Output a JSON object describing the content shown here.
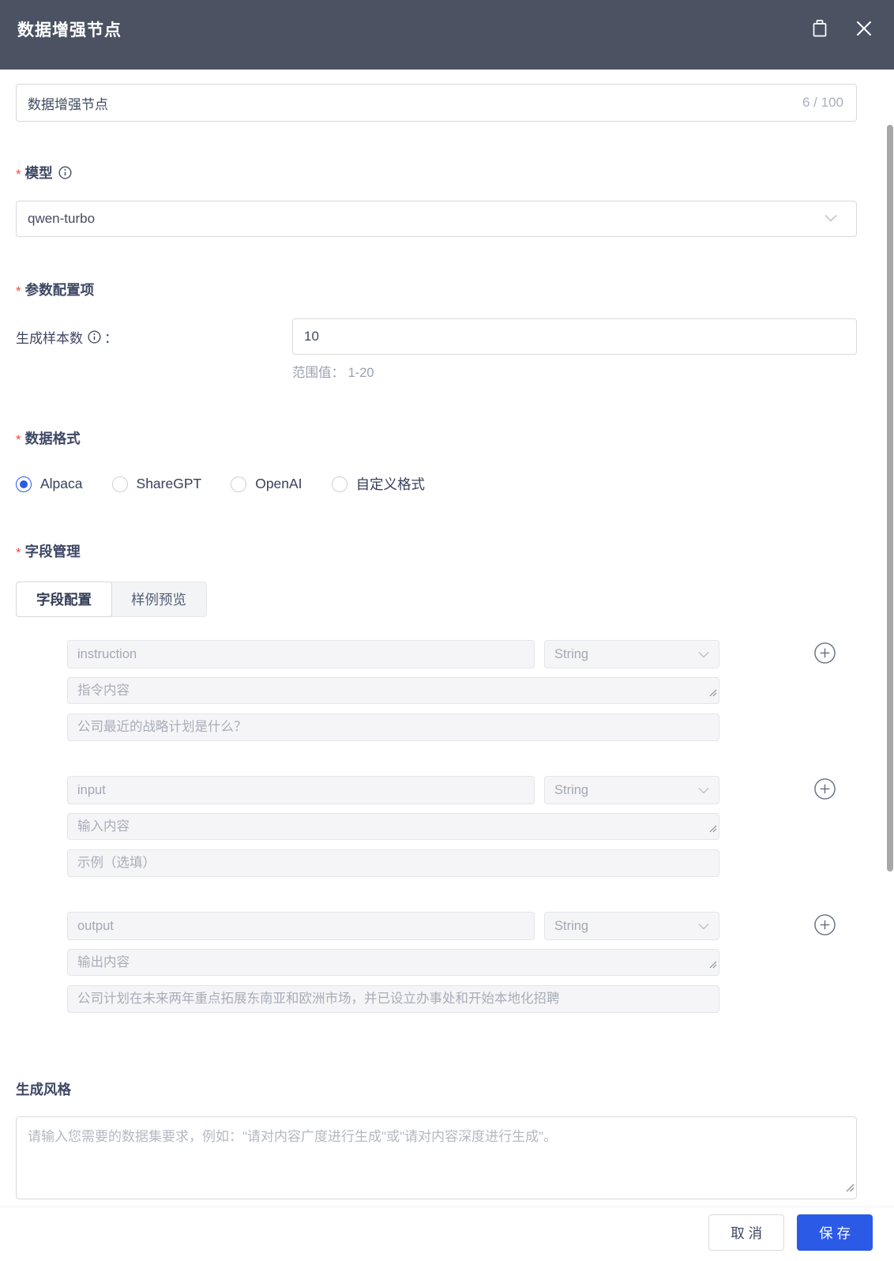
{
  "header": {
    "title": "数据增强节点"
  },
  "name_field": {
    "value": "数据增强节点",
    "counter": "6 / 100"
  },
  "required_mark": "*",
  "model": {
    "label": "模型",
    "value": "qwen-turbo"
  },
  "params": {
    "section_label": "参数配置项",
    "sample_count_label": "生成样本数",
    "label_colon": "：",
    "sample_count_value": "10",
    "range_hint": "范围值： 1-20"
  },
  "data_format": {
    "section_label": "数据格式",
    "options": [
      {
        "label": "Alpaca",
        "selected": true
      },
      {
        "label": "ShareGPT",
        "selected": false
      },
      {
        "label": "OpenAI",
        "selected": false
      },
      {
        "label": "自定义格式",
        "selected": false
      }
    ]
  },
  "field_management": {
    "section_label": "字段管理",
    "tabs": [
      {
        "label": "字段配置",
        "active": true
      },
      {
        "label": "样例预览",
        "active": false
      }
    ],
    "fields": [
      {
        "name": "instruction",
        "type": "String",
        "desc": "指令内容",
        "example": "公司最近的战略计划是什么？"
      },
      {
        "name": "input",
        "type": "String",
        "desc": "输入内容",
        "example": "示例（选填）"
      },
      {
        "name": "output",
        "type": "String",
        "desc": "输出内容",
        "example": "公司计划在未来两年重点拓展东南亚和欧洲市场，并已设立办事处和开始本地化招聘"
      }
    ]
  },
  "generation_style": {
    "label": "生成风格",
    "placeholder": "请输入您需要的数据集要求，例如：\"请对内容广度进行生成\"或\"请对内容深度进行生成\"。"
  },
  "footer": {
    "cancel_label": "取 消",
    "save_label": "保 存"
  },
  "colors": {
    "primary": "#2b5ae6",
    "header_bg": "#4b5362",
    "required": "#f5483b"
  }
}
